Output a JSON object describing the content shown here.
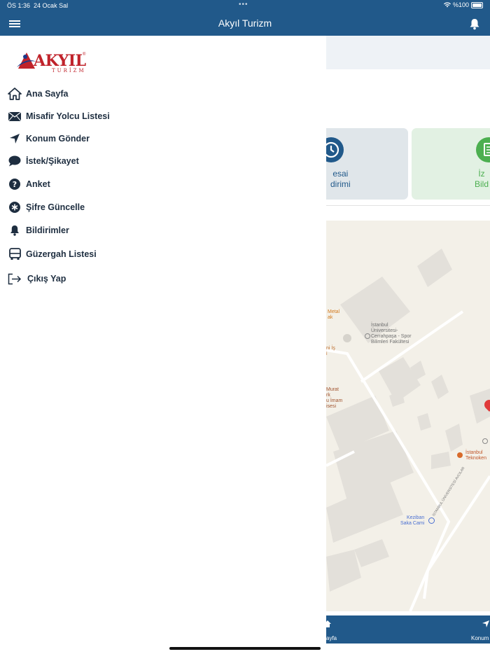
{
  "status_bar": {
    "time": "ÖS 1:36",
    "date": "24 Ocak Sal",
    "battery": "%100"
  },
  "header": {
    "title": "Akyıl Turizm"
  },
  "logo": {
    "name": "AKYIL",
    "sub": "TURİZM",
    "reg": "®"
  },
  "menu": [
    {
      "label": "Ana Sayfa",
      "icon": "home-icon"
    },
    {
      "label": "Misafir Yolcu Listesi",
      "icon": "envelope-icon"
    },
    {
      "label": "Konum Gönder",
      "icon": "location-arrow-icon"
    },
    {
      "label": "İstek/Şikayet",
      "icon": "speech-bubble-icon"
    },
    {
      "label": "Anket",
      "icon": "question-icon"
    },
    {
      "label": "Şifre Güncelle",
      "icon": "asterisk-icon"
    },
    {
      "label": "Bildirimler",
      "icon": "bell-icon"
    },
    {
      "label": "Güzergah Listesi",
      "icon": "bus-icon"
    },
    {
      "label": "Çıkış Yap",
      "icon": "sign-out-icon"
    }
  ],
  "cards": [
    {
      "line1": "esai",
      "line2": "dirimi",
      "color": "#21598a"
    },
    {
      "line1": "İz",
      "line2": "Bild",
      "color": "#4caf50"
    }
  ],
  "map_labels": {
    "metal": "Metal",
    "metal2": "ak",
    "university": "İstanbul Üniversitesi-Cerrahpaşa - Spor Bilimleri Fakültesi",
    "is": "ni İş",
    "is2": "i",
    "murat": "Murat",
    "murat2": "rk",
    "murat3": "u İmam",
    "murat4": "isesi",
    "tekno": "İstanbul Teknoken",
    "cami1": "Keziban",
    "cami2": "Saka Cami",
    "road": "İSTANBUL ÜNİVERSİTESİ AVCILAR"
  },
  "bottom_tabs": {
    "left": "ayfa",
    "right": "Konum"
  }
}
